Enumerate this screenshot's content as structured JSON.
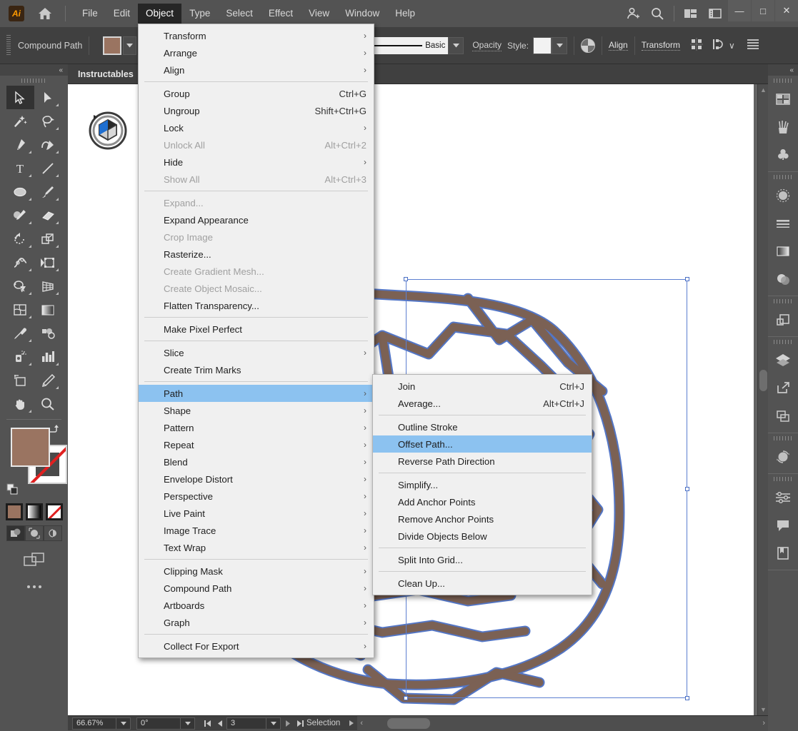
{
  "app": {
    "logo_text": "Ai",
    "home_icon": "home-icon",
    "search_icon": "search-icon",
    "user_icon": "user-add-icon",
    "arrange_docs_icon": "arrange-documents-icon",
    "workspace_icon": "workspace-switcher-icon"
  },
  "menubar": {
    "items": [
      {
        "label": "File",
        "active": false
      },
      {
        "label": "Edit",
        "active": false
      },
      {
        "label": "Object",
        "active": true
      },
      {
        "label": "Type",
        "active": false
      },
      {
        "label": "Select",
        "active": false
      },
      {
        "label": "Effect",
        "active": false
      },
      {
        "label": "View",
        "active": false
      },
      {
        "label": "Window",
        "active": false
      },
      {
        "label": "Help",
        "active": false
      }
    ]
  },
  "window_controls": {
    "minimize": "—",
    "maximize": "□",
    "close": "✕"
  },
  "control_bar": {
    "object_type": "Compound Path",
    "fill_color": "#9a7461",
    "stroke_color": "none",
    "stroke_profile": "Basic",
    "opacity_label": "Opacity",
    "style_label": "Style:",
    "align_label": "Align",
    "transform_label": "Transform",
    "distribute_icon": "distribute-objects-icon",
    "shape_builder_icon": "pathfinder-icon",
    "options_icon": "panel-options-icon",
    "chevron": "∨"
  },
  "document": {
    "tab_title": "Instructables"
  },
  "toolbar": {
    "collapse_label": "«",
    "tools": [
      {
        "name": "selection-tool",
        "selected": true
      },
      {
        "name": "direct-selection-tool",
        "selected": false
      },
      {
        "name": "magic-wand-tool",
        "selected": false
      },
      {
        "name": "lasso-tool",
        "selected": false
      },
      {
        "name": "pen-tool",
        "selected": false
      },
      {
        "name": "curvature-tool",
        "selected": false
      },
      {
        "name": "type-tool",
        "selected": false
      },
      {
        "name": "line-segment-tool",
        "selected": false
      },
      {
        "name": "ellipse-tool",
        "selected": false
      },
      {
        "name": "paintbrush-tool",
        "selected": false
      },
      {
        "name": "shaper-tool",
        "selected": false
      },
      {
        "name": "eraser-tool",
        "selected": false
      },
      {
        "name": "rotate-tool",
        "selected": false
      },
      {
        "name": "scale-tool",
        "selected": false
      },
      {
        "name": "width-tool",
        "selected": false
      },
      {
        "name": "free-transform-tool",
        "selected": false
      },
      {
        "name": "shape-builder-tool",
        "selected": false
      },
      {
        "name": "perspective-grid-tool",
        "selected": false
      },
      {
        "name": "mesh-tool",
        "selected": false
      },
      {
        "name": "gradient-tool",
        "selected": false
      },
      {
        "name": "eyedropper-tool",
        "selected": false
      },
      {
        "name": "blend-tool",
        "selected": false
      },
      {
        "name": "symbol-sprayer-tool",
        "selected": false
      },
      {
        "name": "column-graph-tool",
        "selected": false
      },
      {
        "name": "artboard-tool",
        "selected": false
      },
      {
        "name": "slice-tool",
        "selected": false
      },
      {
        "name": "hand-tool",
        "selected": false
      },
      {
        "name": "zoom-tool",
        "selected": false
      }
    ],
    "fill_swatch": "#9a7461",
    "stroke_swatch": "none",
    "swap_icon": "swap-fill-stroke-icon",
    "default_colors_icon": "default-fill-stroke-icon",
    "color_modes": [
      "flat-color",
      "gradient",
      "none"
    ],
    "draw_modes": [
      "draw-normal",
      "draw-behind",
      "draw-inside"
    ],
    "screen_mode_icon": "change-screen-mode-icon",
    "more_tools_icon": "edit-toolbar-icon"
  },
  "right_dock": {
    "collapse_label": "«",
    "groups": [
      {
        "icons": [
          "properties-panel-icon",
          "brushes-panel-icon",
          "symbols-panel-icon"
        ]
      },
      {
        "icons": [
          "appearance-panel-icon",
          "stroke-panel-icon",
          "gradient-panel-icon",
          "transparency-panel-icon"
        ]
      },
      {
        "icons": [
          "pathfinder-panel-icon"
        ]
      },
      {
        "icons": [
          "layers-panel-icon",
          "artboards-panel-icon",
          "asset-export-panel-icon",
          "align-panel-icon"
        ]
      },
      {
        "icons": [
          "image-trace-panel-icon"
        ]
      },
      {
        "icons": [
          "libraries-panel-icon",
          "comments-panel-icon",
          "document-info-panel-icon"
        ]
      }
    ]
  },
  "object_menu": {
    "title": "Object",
    "items": [
      {
        "label": "Transform",
        "accel": "",
        "submenu": true,
        "disabled": false,
        "highlight": false
      },
      {
        "label": "Arrange",
        "accel": "",
        "submenu": true,
        "disabled": false,
        "highlight": false
      },
      {
        "label": "Align",
        "accel": "",
        "submenu": true,
        "disabled": false,
        "highlight": false
      },
      {
        "separator": true
      },
      {
        "label": "Group",
        "accel": "Ctrl+G",
        "submenu": false,
        "disabled": false,
        "highlight": false
      },
      {
        "label": "Ungroup",
        "accel": "Shift+Ctrl+G",
        "submenu": false,
        "disabled": false,
        "highlight": false
      },
      {
        "label": "Lock",
        "accel": "",
        "submenu": true,
        "disabled": false,
        "highlight": false
      },
      {
        "label": "Unlock All",
        "accel": "Alt+Ctrl+2",
        "submenu": false,
        "disabled": true,
        "highlight": false
      },
      {
        "label": "Hide",
        "accel": "",
        "submenu": true,
        "disabled": false,
        "highlight": false
      },
      {
        "label": "Show All",
        "accel": "Alt+Ctrl+3",
        "submenu": false,
        "disabled": true,
        "highlight": false
      },
      {
        "separator": true
      },
      {
        "label": "Expand...",
        "accel": "",
        "submenu": false,
        "disabled": true,
        "highlight": false
      },
      {
        "label": "Expand Appearance",
        "accel": "",
        "submenu": false,
        "disabled": false,
        "highlight": false
      },
      {
        "label": "Crop Image",
        "accel": "",
        "submenu": false,
        "disabled": true,
        "highlight": false
      },
      {
        "label": "Rasterize...",
        "accel": "",
        "submenu": false,
        "disabled": false,
        "highlight": false
      },
      {
        "label": "Create Gradient Mesh...",
        "accel": "",
        "submenu": false,
        "disabled": true,
        "highlight": false
      },
      {
        "label": "Create Object Mosaic...",
        "accel": "",
        "submenu": false,
        "disabled": true,
        "highlight": false
      },
      {
        "label": "Flatten Transparency...",
        "accel": "",
        "submenu": false,
        "disabled": false,
        "highlight": false
      },
      {
        "separator": true
      },
      {
        "label": "Make Pixel Perfect",
        "accel": "",
        "submenu": false,
        "disabled": false,
        "highlight": false
      },
      {
        "separator": true
      },
      {
        "label": "Slice",
        "accel": "",
        "submenu": true,
        "disabled": false,
        "highlight": false
      },
      {
        "label": "Create Trim Marks",
        "accel": "",
        "submenu": false,
        "disabled": false,
        "highlight": false
      },
      {
        "separator": true
      },
      {
        "label": "Path",
        "accel": "",
        "submenu": true,
        "disabled": false,
        "highlight": true
      },
      {
        "label": "Shape",
        "accel": "",
        "submenu": true,
        "disabled": false,
        "highlight": false
      },
      {
        "label": "Pattern",
        "accel": "",
        "submenu": true,
        "disabled": false,
        "highlight": false
      },
      {
        "label": "Repeat",
        "accel": "",
        "submenu": true,
        "disabled": false,
        "highlight": false
      },
      {
        "label": "Blend",
        "accel": "",
        "submenu": true,
        "disabled": false,
        "highlight": false
      },
      {
        "label": "Envelope Distort",
        "accel": "",
        "submenu": true,
        "disabled": false,
        "highlight": false
      },
      {
        "label": "Perspective",
        "accel": "",
        "submenu": true,
        "disabled": false,
        "highlight": false
      },
      {
        "label": "Live Paint",
        "accel": "",
        "submenu": true,
        "disabled": false,
        "highlight": false
      },
      {
        "label": "Image Trace",
        "accel": "",
        "submenu": true,
        "disabled": false,
        "highlight": false
      },
      {
        "label": "Text Wrap",
        "accel": "",
        "submenu": true,
        "disabled": false,
        "highlight": false
      },
      {
        "separator": true
      },
      {
        "label": "Clipping Mask",
        "accel": "",
        "submenu": true,
        "disabled": false,
        "highlight": false
      },
      {
        "label": "Compound Path",
        "accel": "",
        "submenu": true,
        "disabled": false,
        "highlight": false
      },
      {
        "label": "Artboards",
        "accel": "",
        "submenu": true,
        "disabled": false,
        "highlight": false
      },
      {
        "label": "Graph",
        "accel": "",
        "submenu": true,
        "disabled": false,
        "highlight": false
      },
      {
        "separator": true
      },
      {
        "label": "Collect For Export",
        "accel": "",
        "submenu": true,
        "disabled": false,
        "highlight": false
      }
    ]
  },
  "path_submenu": {
    "title": "Path",
    "items": [
      {
        "label": "Join",
        "accel": "Ctrl+J",
        "submenu": false,
        "disabled": false,
        "highlight": false
      },
      {
        "label": "Average...",
        "accel": "Alt+Ctrl+J",
        "submenu": false,
        "disabled": false,
        "highlight": false
      },
      {
        "separator": true
      },
      {
        "label": "Outline Stroke",
        "accel": "",
        "submenu": false,
        "disabled": false,
        "highlight": false
      },
      {
        "label": "Offset Path...",
        "accel": "",
        "submenu": false,
        "disabled": false,
        "highlight": true
      },
      {
        "label": "Reverse Path Direction",
        "accel": "",
        "submenu": false,
        "disabled": false,
        "highlight": false
      },
      {
        "separator": true
      },
      {
        "label": "Simplify...",
        "accel": "",
        "submenu": false,
        "disabled": false,
        "highlight": false
      },
      {
        "label": "Add Anchor Points",
        "accel": "",
        "submenu": false,
        "disabled": false,
        "highlight": false
      },
      {
        "label": "Remove Anchor Points",
        "accel": "",
        "submenu": false,
        "disabled": false,
        "highlight": false
      },
      {
        "label": "Divide Objects Below",
        "accel": "",
        "submenu": false,
        "disabled": false,
        "highlight": false
      },
      {
        "separator": true
      },
      {
        "label": "Split Into Grid...",
        "accel": "",
        "submenu": false,
        "disabled": false,
        "highlight": false
      },
      {
        "separator": true
      },
      {
        "label": "Clean Up...",
        "accel": "",
        "submenu": false,
        "disabled": false,
        "highlight": false
      }
    ]
  },
  "status_bar": {
    "zoom": "66.67%",
    "rotation": "0°",
    "artboard_number": "3",
    "status_text": "Selection",
    "first_icon": "first-artboard-icon",
    "prev_icon": "previous-artboard-icon",
    "next_icon": "next-artboard-icon",
    "last_icon": "last-artboard-icon"
  },
  "artwork": {
    "stroke_color": "#7b6154",
    "selection_color": "#4a6fc4",
    "description": "geometric polygonal brain illustration"
  }
}
